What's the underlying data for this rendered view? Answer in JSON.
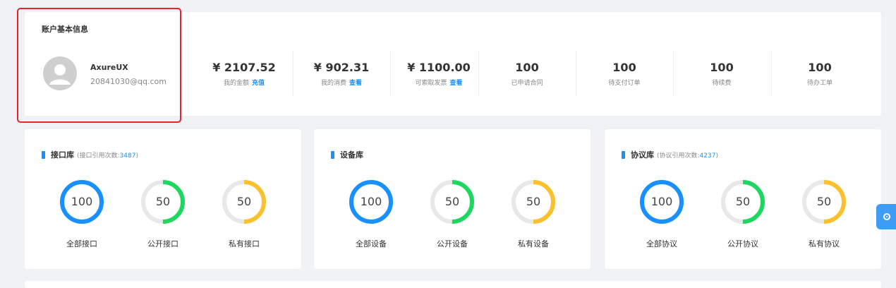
{
  "account": {
    "title": "账户基本信息",
    "name": "AxureUX",
    "email": "20841030@qq.com",
    "highlight_color": "#e8232b"
  },
  "stats": [
    {
      "value": "¥ 2107.52",
      "label": "我的金额",
      "link": "充值"
    },
    {
      "value": "¥ 902.31",
      "label": "我的消费",
      "link": "查看"
    },
    {
      "value": "¥ 1100.00",
      "label": "可索取发票",
      "link": "查看"
    },
    {
      "value": "100",
      "label": "已申请合同",
      "link": ""
    },
    {
      "value": "100",
      "label": "待支付订单",
      "link": ""
    },
    {
      "value": "100",
      "label": "待续费",
      "link": ""
    },
    {
      "value": "100",
      "label": "待办工单",
      "link": ""
    }
  ],
  "libraries": [
    {
      "title": "接口库",
      "note_prefix": "(接口引用次数:",
      "count": "3487",
      "note_suffix": ")",
      "rings": [
        {
          "value": "100",
          "label": "全部接口",
          "color": "#1890ff",
          "fraction": 1.0
        },
        {
          "value": "50",
          "label": "公开接口",
          "color": "#1ed760",
          "fraction": 0.5
        },
        {
          "value": "50",
          "label": "私有接口",
          "color": "#fbc02d",
          "fraction": 0.5
        }
      ]
    },
    {
      "title": "设备库",
      "note_prefix": "",
      "count": "",
      "note_suffix": "",
      "rings": [
        {
          "value": "100",
          "label": "全部设备",
          "color": "#1890ff",
          "fraction": 1.0
        },
        {
          "value": "50",
          "label": "公开设备",
          "color": "#1ed760",
          "fraction": 0.5
        },
        {
          "value": "50",
          "label": "私有设备",
          "color": "#fbc02d",
          "fraction": 0.5
        }
      ]
    },
    {
      "title": "协议库",
      "note_prefix": "(协议引用次数:",
      "count": "4237",
      "note_suffix": ")",
      "rings": [
        {
          "value": "100",
          "label": "全部协议",
          "color": "#1890ff",
          "fraction": 1.0
        },
        {
          "value": "50",
          "label": "公开协议",
          "color": "#1ed760",
          "fraction": 0.5
        },
        {
          "value": "50",
          "label": "私有协议",
          "color": "#fbc02d",
          "fraction": 0.5
        }
      ]
    }
  ],
  "colors": {
    "accent": "#1890ff",
    "ring_track": "#e8e8e8"
  },
  "float_button": {
    "icon": "target-icon"
  }
}
